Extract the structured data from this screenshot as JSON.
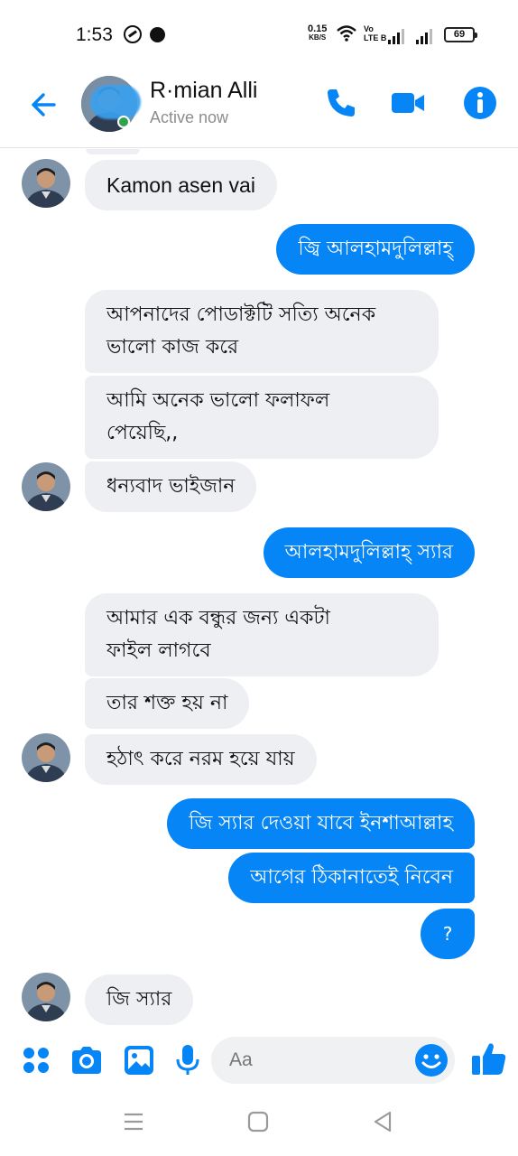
{
  "status_bar": {
    "time": "1:53",
    "net_speed_value": "0.15",
    "net_speed_unit": "KB/S",
    "volte_top": "Vo",
    "volte_bottom": "LTE B",
    "battery": "69"
  },
  "header": {
    "contact_name": "R·mian Alli",
    "contact_status": "Active now",
    "accent_color": "#0685f7"
  },
  "conversation": {
    "messages": [
      {
        "direction": "in",
        "text": "Kamon asen vai"
      },
      {
        "direction": "out",
        "text": "জ্বি আলহামদুলিল্লাহ্"
      },
      {
        "direction": "in",
        "text": "আপনাদের পোডাক্টটি সত্যি অনেক\nভালো কাজ করে"
      },
      {
        "direction": "in",
        "text": "আমি অনেক ভালো ফলাফল\nপেয়েছি,,"
      },
      {
        "direction": "in",
        "text": "ধন্যবাদ ভাইজান"
      },
      {
        "direction": "out",
        "text": "আলহামদুলিল্লাহ্ স্যার"
      },
      {
        "direction": "in",
        "text": "আমার এক বন্ধুর জন্য একটা\nফাইল লাগবে"
      },
      {
        "direction": "in",
        "text": "তার শক্ত হয় না"
      },
      {
        "direction": "in",
        "text": "হঠাৎ করে নরম হয়ে যায়"
      },
      {
        "direction": "out",
        "text": "জি স্যার দেওয়া যাবে ইনশাআল্লাহ"
      },
      {
        "direction": "out",
        "text": "আগের ঠিকানাতেই নিবেন"
      },
      {
        "direction": "out",
        "text": "?"
      },
      {
        "direction": "in",
        "text": "জি স্যার"
      }
    ]
  },
  "composer": {
    "placeholder": "Aa",
    "icons": [
      "apps-icon",
      "camera-icon",
      "gallery-icon",
      "microphone-icon",
      "emoji-icon",
      "like-icon"
    ]
  },
  "navbar": {
    "icons": [
      "recents-icon",
      "home-icon",
      "back-nav-icon"
    ]
  }
}
